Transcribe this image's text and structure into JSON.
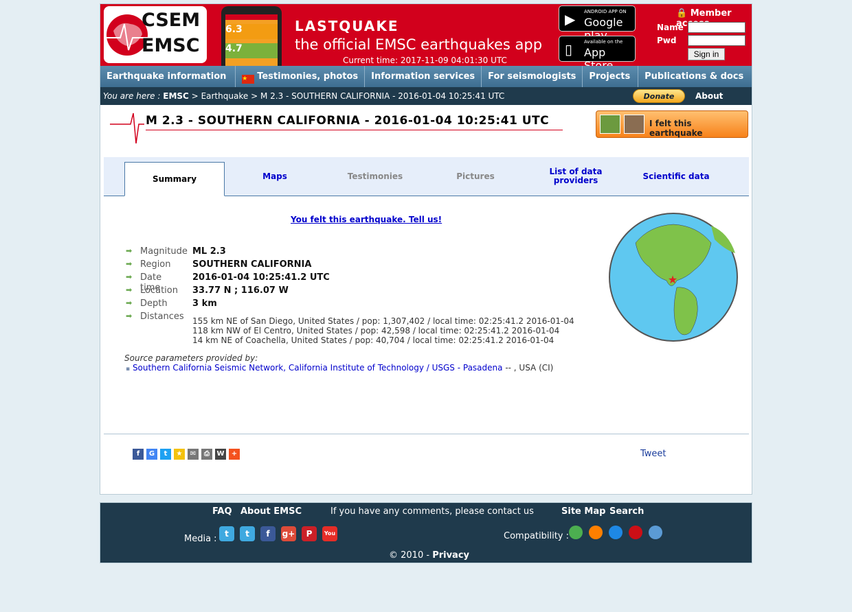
{
  "header": {
    "logo_top": "CSEM",
    "logo_bottom": "EMSC",
    "phone_value_1": "6.3",
    "phone_value_2": "4.7",
    "app_title": "LASTQUAKE",
    "app_subtitle": "the official EMSC earthquakes app",
    "current_time": "Current time: 2017-11-09 04:01:30 UTC",
    "google_play_small": "ANDROID APP ON",
    "google_play": "Google play",
    "app_store_small": "Available on the",
    "app_store": "App Store",
    "member_access": "Member access",
    "name_label": "Name",
    "pwd_label": "Pwd",
    "sign_in": "Sign in"
  },
  "nav": [
    "Earthquake information",
    "Testimonies, photos",
    "Information services",
    "For seismologists",
    "Projects",
    "Publications & docs"
  ],
  "breadcrumb": {
    "prefix": "You are here :",
    "emsc": "EMSC",
    "sep": ">",
    "earthquake": "Earthquake",
    "current": "M 2.3 - SOUTHERN CALIFORNIA - 2016-01-04 10:25:41 UTC",
    "donate": "Donate",
    "about": "About EMSC"
  },
  "event": {
    "title": "M 2.3 - SOUTHERN CALIFORNIA - 2016-01-04 10:25:41 UTC",
    "felt_button": "I felt this earthquake",
    "felt_link": "You felt this earthquake. Tell us!"
  },
  "tabs": [
    "Summary",
    "Maps",
    "Testimonies",
    "Pictures",
    "List of data providers",
    "Scientific data"
  ],
  "details": [
    {
      "label": "Magnitude",
      "value": "ML 2.3"
    },
    {
      "label": "Region",
      "value": "SOUTHERN CALIFORNIA"
    },
    {
      "label": "Date time",
      "value": "2016-01-04 10:25:41.2 UTC"
    },
    {
      "label": "Location",
      "value": "33.77 N ; 116.07 W"
    },
    {
      "label": "Depth",
      "value": "3 km"
    },
    {
      "label": "Distances",
      "value": ""
    }
  ],
  "distances": [
    "155 km NE of San Diego, United States / pop: 1,307,402 / local time: 02:25:41.2 2016-01-04",
    "118 km NW of El Centro, United States / pop: 42,598 / local time: 02:25:41.2 2016-01-04",
    "14 km NE of Coachella, United States / pop: 40,704 / local time: 02:25:41.2 2016-01-04"
  ],
  "source": {
    "label": "Source parameters provided by:",
    "network": "Southern California Seismic Network, California Institute of Technology / USGS - Pasadena",
    "suffix": "-- , USA (CI)"
  },
  "share": {
    "tweet": "Tweet",
    "icons": [
      "f",
      "G",
      "t",
      "★",
      "✉",
      "⎙",
      "W",
      "+"
    ],
    "colors": [
      "#3b5998",
      "#4285f4",
      "#1da1f2",
      "#f4c20d",
      "#777777",
      "#777777",
      "#464646",
      "#f4511e"
    ]
  },
  "footer": {
    "faq": "FAQ",
    "about": "About EMSC",
    "comments": "If you have any comments, please contact us",
    "sitemap": "Site Map",
    "search": "Search",
    "media": "Media :",
    "compat": "Compatibility :",
    "copyright": "© 2010 -",
    "privacy": "Privacy",
    "media_icons": [
      "t",
      "t",
      "f",
      "g+",
      "P",
      "You"
    ],
    "media_colors": [
      "#3fa9e0",
      "#3fa9e0",
      "#3b5998",
      "#dd4b39",
      "#cb2027",
      "#e52d27"
    ],
    "browser_colors": [
      "#4caf50",
      "#ff7f00",
      "#1e88e5",
      "#cc0f16",
      "#5b9bd5"
    ]
  },
  "colors": {
    "brand_red": "#d2001c",
    "nav_blue": "#4a7ba0",
    "dark_bar": "#1f3a4c",
    "link": "#0000cc"
  }
}
